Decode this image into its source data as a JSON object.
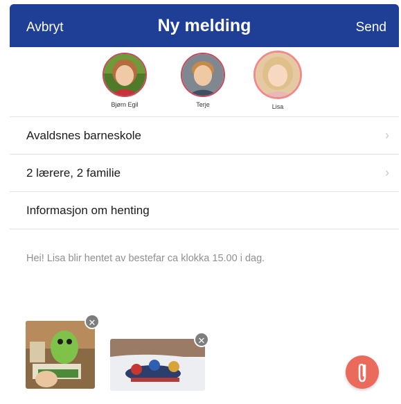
{
  "navbar": {
    "cancel_label": "Avbryt",
    "title": "Ny melding",
    "send_label": "Send"
  },
  "recipients": [
    {
      "name": "Bjørn Egil",
      "selected": false
    },
    {
      "name": "Terje",
      "selected": false
    },
    {
      "name": "Lisa",
      "selected": true
    }
  ],
  "details": {
    "school": "Avaldsnes barneskole",
    "audience": "2 lærere, 2 familie",
    "subject": "Informasjon om henting"
  },
  "message": {
    "body": "Hei! Lisa blir hentet av bestefar ca klokka 15.00 i dag."
  },
  "attachments": [
    {
      "icon": "remove-icon",
      "remove_glyph": "✕"
    },
    {
      "icon": "remove-icon",
      "remove_glyph": "✕"
    }
  ],
  "icons": {
    "chevron": "›",
    "attach": "paperclip-icon"
  },
  "colors": {
    "navbar": "#1f3f96",
    "accent": "#ea6a5c",
    "selected_ring": "#f08a8a"
  }
}
